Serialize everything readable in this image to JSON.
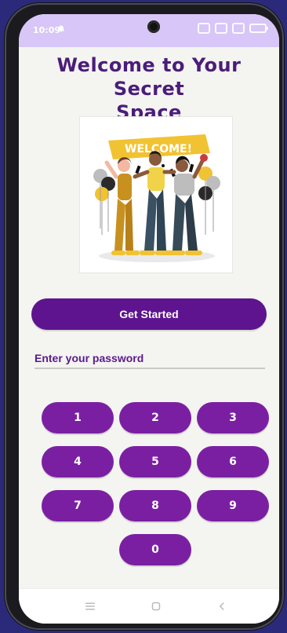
{
  "status": {
    "time": "10:09"
  },
  "title": {
    "line1": "Welcome to Your Secret",
    "line2": "Space"
  },
  "illustration": {
    "banner_text": "WELCOME!"
  },
  "actions": {
    "get_started": "Get Started"
  },
  "password": {
    "placeholder": "Enter your password",
    "value": ""
  },
  "keypad": {
    "keys": [
      "1",
      "2",
      "3",
      "4",
      "5",
      "6",
      "7",
      "8",
      "9",
      "0"
    ]
  },
  "colors": {
    "primary_dark": "#5d148e",
    "primary": "#7b1fa2",
    "status_bar": "#d7c6f7",
    "background": "#f4f4f1"
  },
  "icons": {
    "bell": "bell-icon",
    "nav_menu": "menu-icon",
    "nav_home": "home-icon",
    "nav_back": "back-icon"
  }
}
